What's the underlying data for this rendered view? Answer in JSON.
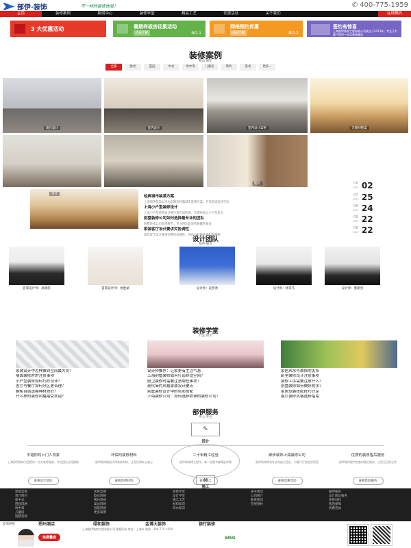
{
  "header": {
    "logo": "部伊·装饰",
    "slogan": "不一样的装修体验！",
    "phone": "400-775-1959"
  },
  "nav": {
    "items": [
      "主页",
      "装修案例",
      "新闻中心",
      "装修学堂",
      "精品工艺",
      "优惠活动",
      "关于我们"
    ],
    "cta": "在线预约"
  },
  "promo": {
    "c1": {
      "title": "3 大优惠活动"
    },
    "c2": {
      "title": "暑期样板房征集活动",
      "btn": "点击了解",
      "num": "NO.1"
    },
    "c3": {
      "title": "网络预约优惠",
      "btn": "点击了解",
      "num": "NO.2"
    },
    "c4": {
      "title": "签约有惊喜",
      "text": "上海部伊装饰工程有限公司成立于2013年，专注于为客户提供一站式装修服务"
    }
  },
  "cases": {
    "title": "装修案例",
    "sub": "精品·展示",
    "tabs": [
      "全部",
      "欧式",
      "田园",
      "中式",
      "地中海",
      "儿童房",
      "简约",
      "美式",
      "更多..."
    ],
    "captions": [
      "现代设计",
      "室内设计",
      "室内设计案例",
      "无锡别墅案",
      "图片",
      "现代"
    ]
  },
  "news": {
    "items": [
      {
        "title": "经典城市装潢方案",
        "summary": "上海部伊装饰公司为您精选经典城市装潢方案，打造舒适居住空间",
        "month": "09",
        "year": "2017",
        "day": "02"
      },
      {
        "title": "上海小户型装修设计",
        "summary": "上海小户型装修设计要注意空间利用，合理布局让小户型变大",
        "month": "07",
        "year": "2017",
        "day": "25"
      },
      {
        "title": "别墅装修公司如何选择最专业的团队",
        "summary": "别墅装修公司选择要点，专业团队是装修质量的保证",
        "month": "06",
        "year": "2017",
        "day": "24"
      },
      {
        "title": "家装客厅设计要讲究协调性",
        "summary": "家装客厅设计要讲究整体协调性，色彩与材质的搭配很重要",
        "month": "06",
        "year": "2017",
        "day": "22"
      },
      {
        "title": "",
        "summary": "",
        "month": "06",
        "year": "2017",
        "day": "22"
      }
    ]
  },
  "team": {
    "title": "设计团队",
    "sub": "精英·服务",
    "members": [
      "首席设计师：高建忠",
      "首席设计师：杨胜斌",
      "设计师：赵彦青",
      "设计师：杨可凡",
      "设计师：鲁斯亮"
    ]
  },
  "study": {
    "title": "装修学堂",
    "sub": "行业·知识",
    "col1": [
      "家装设计中怎样做到空间最大化？",
      "墙面装修时的注意事项",
      "小户型装修如何巧妙设计？",
      "客厅与餐厅如何分区更合理？",
      "橱柜台面选哪种材质好？",
      "什么样的装修风格最受欢迎？"
    ],
    "col2": [
      "设计师推荐：让家更有生活气息",
      "上海别墅装修如何打造舒适空间？",
      "厨卫装修时需要注意哪些事项？",
      "现代简约风格家装设计要点",
      "别墅装修设计中的色彩搭配",
      "上海装修公司：如何选择靠谱的装修公司？"
    ],
    "col3": [
      "家居风水与装修的关系",
      "卧室装修设计注意事项",
      "装修工序需要注意什么？",
      "别墅装修如何做好防水？",
      "家居软装搭配技巧分享",
      "客厅装修风格选择指南"
    ]
  },
  "service": {
    "title": "部伊服务",
    "sub": "专心·专业",
    "design_label": "设计",
    "build_label": "施工",
    "cols": [
      {
        "h": "不错你的上门人员家",
        "d": "上海部伊装饰为您提供一站式装修服务，专业团队全程跟踪",
        "btn": "查看设计团队"
      },
      {
        "h": "环保的装修材料",
        "d": "部伊装饰精选环保装修材料，让您住得安心放心",
        "btn": "查看装修材料"
      },
      {
        "h": "二十年精工经验",
        "d": "部伊装饰精工细作，每一处细节都精益求精",
        "btn": "查看施工"
      },
      {
        "h": "部伊装饰上海装修公司",
        "d": "部伊装饰拥有专业的施工团队，为客户打造品质家居",
        "btn": "查看优惠活动"
      },
      {
        "h": "优质的装修售后服务",
        "d": "部伊装饰提供完善的售后服务，让您无后顾之忧",
        "btn": "查看售后服务"
      }
    ]
  },
  "footer": {
    "cols": [
      [
        "装修案例",
        "现代简约",
        "新中式",
        "田园风格",
        "地中海",
        "儿童房",
        "别墅装修"
      ],
      [
        "装修案例",
        "欧式风格",
        "简约风格",
        "美式风格",
        "混搭风格",
        "更多案例"
      ],
      [
        "装修学堂",
        "设计学堂",
        "施工工艺",
        "材料知识",
        "风水知识"
      ],
      [
        "关于我们",
        "公司简介",
        "联系我们",
        "在线预约"
      ],
      [
        "部伊服务",
        "设计团队服务",
        "装修材料",
        "售后保障",
        "优惠活动"
      ]
    ],
    "tabs": [
      "郑州酒店",
      "绿和装饰",
      "金博大装饰",
      "银行装修"
    ],
    "label": "友情链接",
    "copyright": "上海部伊装饰工程有限公司 版权所有 地址：上海市 电话：400-775-1959",
    "free_badge": "免费量房"
  }
}
